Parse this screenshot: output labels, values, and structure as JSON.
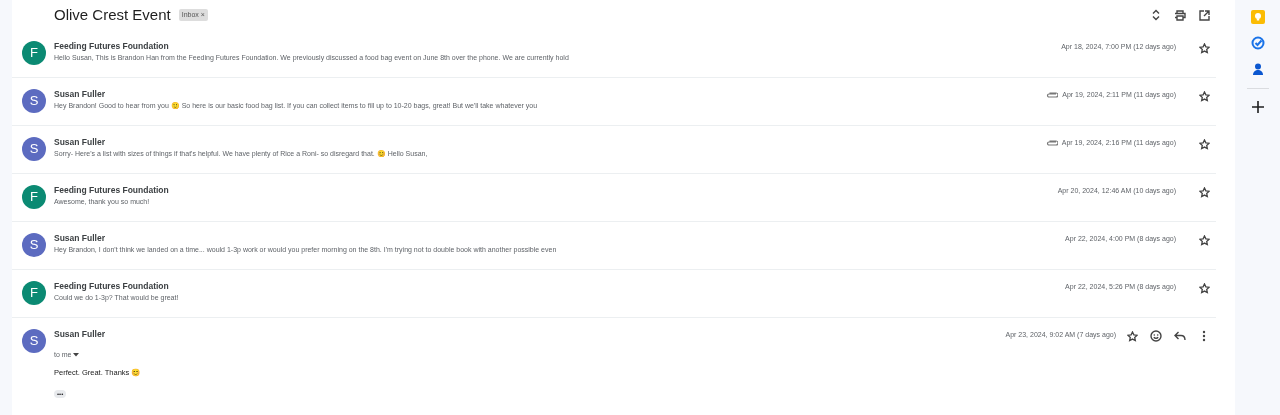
{
  "thread": {
    "subject": "Olive Crest Event",
    "label_chip": "Inbox",
    "label_remove": "×"
  },
  "messages": [
    {
      "kind": "collapsed",
      "sender": "Feeding Futures Foundation",
      "avatar": "F",
      "color": "#0b8a73",
      "snippet": "Hello Susan, This is Brandon Han from the Feeding Futures Foundation. We previously discussed a food bag event on June 8th over the phone. We are currently hold",
      "date": "Apr 18, 2024, 7:00 PM (12 days ago)",
      "attachment": false
    },
    {
      "kind": "collapsed",
      "sender": "Susan Fuller",
      "avatar": "S",
      "color": "#5c6bc0",
      "snippet": "Hey Brandon! Good to hear from you 🙂 So here is our basic food bag list. If you can collect items to fill up to 10-20 bags, great! But we'll take whatever you",
      "date": "Apr 19, 2024, 2:11 PM (11 days ago)",
      "attachment": true
    },
    {
      "kind": "collapsed",
      "sender": "Susan Fuller",
      "avatar": "S",
      "color": "#5c6bc0",
      "snippet": "Sorry- Here's a list with sizes of things if that's helpful. We have plenty of Rice a Roni- so disregard that. 😊 Hello Susan,",
      "date": "Apr 19, 2024, 2:16 PM (11 days ago)",
      "attachment": true
    },
    {
      "kind": "collapsed",
      "sender": "Feeding Futures Foundation",
      "avatar": "F",
      "color": "#0b8a73",
      "snippet": "Awesome, thank you so much!",
      "date": "Apr 20, 2024, 12:46 AM (10 days ago)",
      "attachment": false
    },
    {
      "kind": "collapsed",
      "sender": "Susan Fuller",
      "avatar": "S",
      "color": "#5c6bc0",
      "snippet": "Hey Brandon, I don't think we landed on a time... would 1-3p work or would you prefer morning on the 8th. I'm trying not to double book with another possible even",
      "date": "Apr 22, 2024, 4:00 PM (8 days ago)",
      "attachment": false
    },
    {
      "kind": "collapsed",
      "sender": "Feeding Futures Foundation",
      "avatar": "F",
      "color": "#0b8a73",
      "snippet": "Could we do 1-3p? That would be great!",
      "date": "Apr 22, 2024, 5:26 PM (8 days ago)",
      "attachment": false
    },
    {
      "kind": "expanded",
      "sender": "Susan Fuller",
      "avatar": "S",
      "color": "#5c6bc0",
      "recipient": "to me",
      "body": "Perfect. Great. Thanks 😊",
      "trimmed": "•••",
      "date": "Apr 23, 2024, 9:02 AM (7 days ago)",
      "attachment": false
    }
  ]
}
